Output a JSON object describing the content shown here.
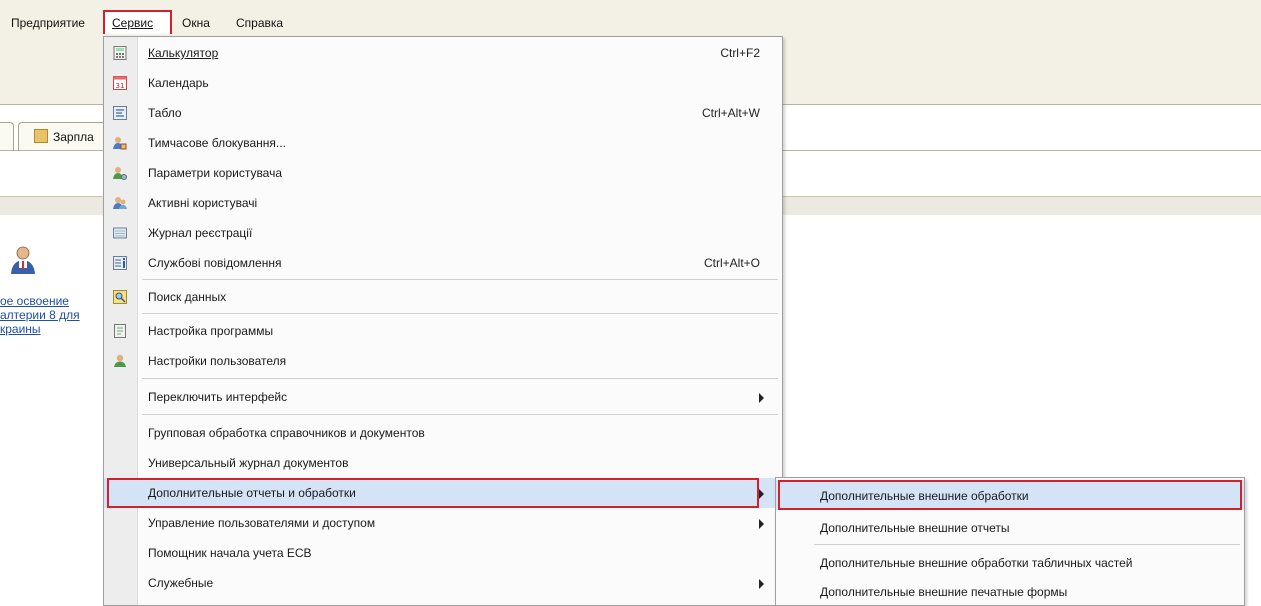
{
  "menubar": {
    "items": [
      {
        "label": "Предприятие"
      },
      {
        "label": "Сервис"
      },
      {
        "label": "Окна"
      },
      {
        "label": "Справка"
      }
    ]
  },
  "background": {
    "tab_label": "Зарпла",
    "left_links": [
      "ое освоение",
      "алтерии 8 для",
      "краины"
    ]
  },
  "service_menu": {
    "items": [
      {
        "label": "Калькулятор",
        "shortcut": "Ctrl+F2",
        "icon": "calculator-icon"
      },
      {
        "label": "Календарь",
        "shortcut": "",
        "icon": "calendar-icon",
        "icon_text": "31"
      },
      {
        "label": "Табло",
        "shortcut": "Ctrl+Alt+W",
        "icon": "scoreboard-icon"
      },
      {
        "label": "Тимчасове блокування...",
        "shortcut": "",
        "icon": "users-lock-icon"
      },
      {
        "label": "Параметри користувача",
        "shortcut": "",
        "icon": "user-settings-icon"
      },
      {
        "label": "Активні користувачі",
        "shortcut": "",
        "icon": "active-users-icon"
      },
      {
        "label": "Журнал реєстрації",
        "shortcut": "",
        "icon": "log-icon"
      },
      {
        "label": "Службові повідомлення",
        "shortcut": "Ctrl+Alt+O",
        "icon": "messages-icon"
      },
      {
        "label": "Поиск данных",
        "shortcut": "",
        "icon": "search-data-icon"
      },
      {
        "label": "Настройка программы",
        "shortcut": "",
        "icon": "program-settings-icon"
      },
      {
        "label": "Настройки пользователя",
        "shortcut": "",
        "icon": "user-icon"
      },
      {
        "label": "Переключить интерфейс",
        "shortcut": "",
        "submenu": true
      },
      {
        "label": "Групповая обработка справочников и документов",
        "shortcut": ""
      },
      {
        "label": "Универсальный журнал документов",
        "shortcut": ""
      },
      {
        "label": "Дополнительные отчеты и обработки",
        "shortcut": "",
        "submenu": true,
        "selected": true
      },
      {
        "label": "Управление пользователями и доступом",
        "shortcut": "",
        "submenu": true
      },
      {
        "label": "Помощник начала учета ЕСВ",
        "shortcut": ""
      },
      {
        "label": "Служебные",
        "shortcut": "",
        "submenu": true
      }
    ]
  },
  "submenu": {
    "items": [
      {
        "label": "Дополнительные внешние обработки",
        "selected": true
      },
      {
        "label": "Дополнительные внешние отчеты"
      },
      {
        "label": "Дополнительные внешние обработки табличных частей"
      },
      {
        "label": "Дополнительные внешние печатные формы"
      }
    ]
  },
  "colors": {
    "highlight_border": "#d3202f",
    "selected_bg": "#d5e3f6",
    "link": "#1f4fa6"
  }
}
